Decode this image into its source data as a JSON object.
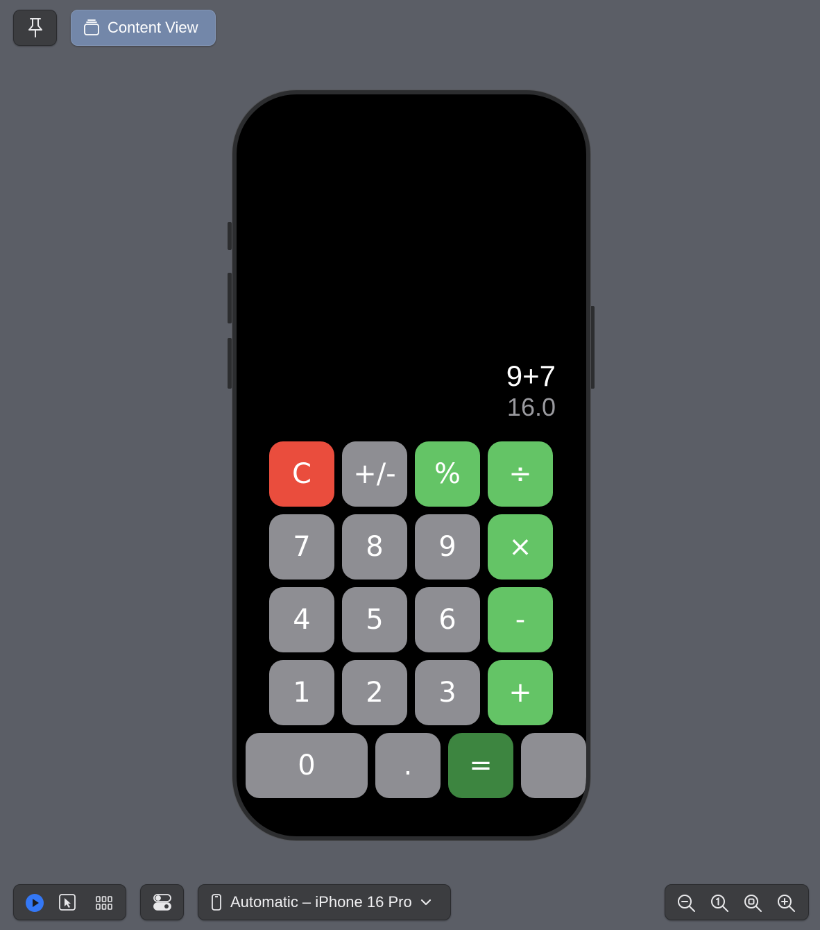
{
  "toolbar_top": {
    "pin_icon": "pin-icon",
    "content_view_label": "Content View",
    "content_view_icon": "stack-icon"
  },
  "calculator": {
    "expression": "9+7",
    "result": "16.0",
    "keys": [
      {
        "label": "C",
        "style": "red"
      },
      {
        "label": "+/-",
        "style": "gray"
      },
      {
        "label": "%",
        "style": "green"
      },
      {
        "label": "÷",
        "style": "green"
      },
      {
        "label": "7",
        "style": "gray"
      },
      {
        "label": "8",
        "style": "gray"
      },
      {
        "label": "9",
        "style": "gray"
      },
      {
        "label": "×",
        "style": "green"
      },
      {
        "label": "4",
        "style": "gray"
      },
      {
        "label": "5",
        "style": "gray"
      },
      {
        "label": "6",
        "style": "gray"
      },
      {
        "label": "-",
        "style": "green"
      },
      {
        "label": "1",
        "style": "gray"
      },
      {
        "label": "2",
        "style": "gray"
      },
      {
        "label": "3",
        "style": "gray"
      },
      {
        "label": "+",
        "style": "green"
      },
      {
        "label": "0",
        "style": "gray"
      },
      {
        "label": ".",
        "style": "gray"
      },
      {
        "label": "=",
        "style": "dark-green"
      },
      {
        "label": "",
        "style": "gray"
      }
    ],
    "colors": {
      "red": "#ea4d3d",
      "gray": "#8e8e93",
      "green": "#64c466",
      "dark_green": "#3d8540"
    }
  },
  "toolbar_bottom": {
    "mode_icons": [
      "live-play-icon",
      "selectable-cursor-icon",
      "variants-grid-icon"
    ],
    "settings_icon": "device-settings-toggle-icon",
    "device_label": "Automatic – iPhone 16 Pro",
    "device_icon": "iphone-icon",
    "zoom_icons": [
      "zoom-out-icon",
      "zoom-100-icon",
      "zoom-fit-icon",
      "zoom-in-icon"
    ]
  }
}
